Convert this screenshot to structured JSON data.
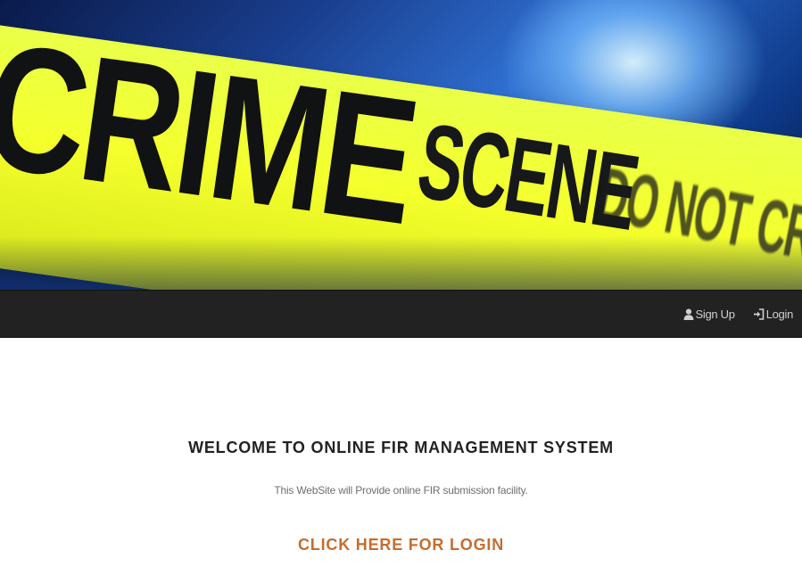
{
  "hero": {
    "tape_line1": "CRIME",
    "tape_line2": "SCENE",
    "tape_line3": "DO NOT CROSS"
  },
  "navbar": {
    "items": [
      {
        "label": "Sign Up",
        "icon": "user-icon"
      },
      {
        "label": "Login",
        "icon": "login-icon"
      }
    ]
  },
  "main": {
    "heading": "WELCOME TO ONLINE FIR MANAGEMENT SYSTEM",
    "subtitle": "This WebSite will Provide online FIR submission facility.",
    "cta_label": "CLICK HERE FOR LOGIN"
  },
  "colors": {
    "navbar_bg": "#222222",
    "nav_text": "#d0d0d0",
    "heading": "#222222",
    "cta": "#c56d2f",
    "tape": "#f4ff2c"
  }
}
